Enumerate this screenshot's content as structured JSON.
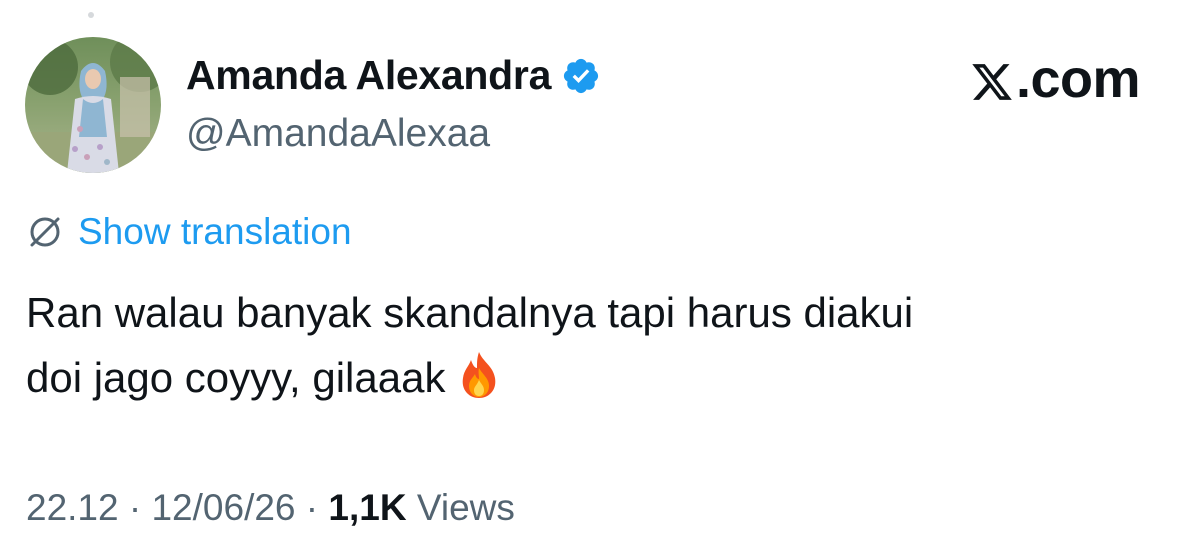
{
  "author": {
    "name": "Amanda Alexandra",
    "handle": "@AmandaAlexaa",
    "verified_color": "#1d9bf0"
  },
  "brand": {
    "label": ".com",
    "logo_icon": "x-logo-icon"
  },
  "translation": {
    "icon": "globe-slash-icon",
    "label": "Show translation",
    "color": "#1d9bf0"
  },
  "tweet": {
    "line1": "Ran walau banyak skandalnya tapi harus diakui",
    "line2": "doi jago coyyy, gilaaak",
    "emoji": "fire-icon"
  },
  "meta": {
    "time": "22.12",
    "sep1": " · ",
    "date": "12/06/26",
    "sep2": " · ",
    "views_count": "1,1K",
    "views_label": " Views"
  }
}
